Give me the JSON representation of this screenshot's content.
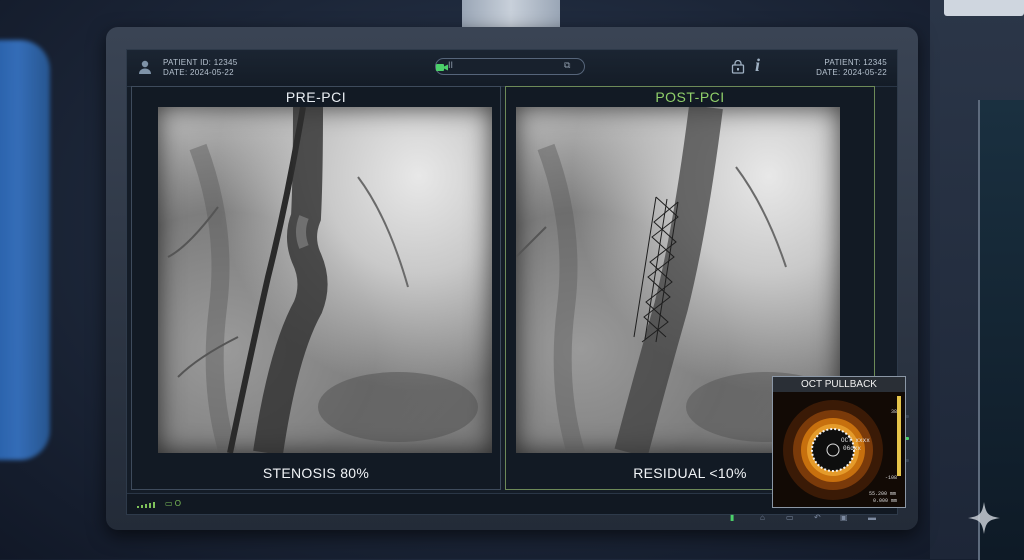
{
  "header": {
    "patient_id_left": "PATIENT ID: 12345",
    "date_left": "DATE: 2024-05-22",
    "patient_right": "PATIENT: 12345",
    "date_right": "DATE: 2024-05-22",
    "ctrl_left": "II",
    "ctrl_right": "⧉",
    "info_glyph": "i"
  },
  "panels": {
    "pre": {
      "title": "PRE-PCI",
      "caption": "STENOSIS 80%"
    },
    "post": {
      "title": "POST-PCI",
      "caption": "RESIDUAL <10%"
    }
  },
  "oct": {
    "title": "OCT PULLBACK",
    "center_label": "OCT xxxx",
    "center_sub": "06dxx",
    "scale_top": "38",
    "scale_mid": "-108",
    "scale_bottom_1": "55.200 mm",
    "scale_bottom_2": "0.000 mm"
  },
  "status": {
    "battery": "▭ O"
  },
  "colors": {
    "accent_green": "#8fcf6a",
    "post_border": "#6d8a58",
    "active_green": "#4bd06a"
  }
}
